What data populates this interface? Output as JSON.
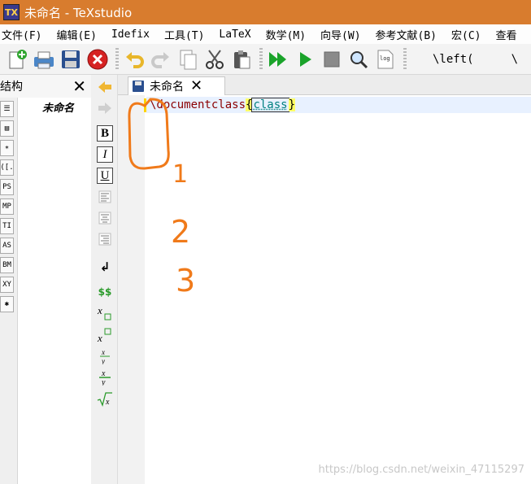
{
  "window": {
    "title": "未命名 - TeXstudio"
  },
  "menu": {
    "items": [
      "文件(F)",
      "编辑(E)",
      "Idefix",
      "工具(T)",
      "LaTeX",
      "数学(M)",
      "向导(W)",
      "参考文献(B)",
      "宏(C)",
      "查看"
    ]
  },
  "toolbar": {
    "left_command": "\\left(",
    "right_command": "\\"
  },
  "structure": {
    "title": "结构",
    "doc_name": "未命名",
    "strip_labels": [
      "☰",
      "▤",
      "∗",
      "([.",
      "PS",
      "MP",
      "TI",
      "AS",
      "BM",
      "XY",
      "✱"
    ]
  },
  "editor": {
    "tab_label": "未命名",
    "code": {
      "command": "\\documentclass",
      "open_brace": "{",
      "argument": "class",
      "close_brace": "}"
    }
  },
  "annotations": {
    "numbers": [
      "1",
      "2",
      "3"
    ],
    "color": "#f07a1a"
  },
  "watermark": "https://blog.csdn.net/weixin_47115297"
}
